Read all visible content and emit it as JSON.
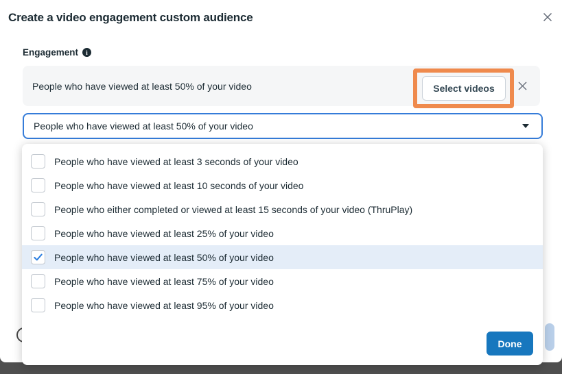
{
  "modal": {
    "title": "Create a video engagement custom audience"
  },
  "engagement": {
    "label": "Engagement",
    "info_icon_glyph": "i",
    "rule_row": {
      "text": "People who have viewed at least 50% of your video",
      "select_videos_label": "Select videos"
    },
    "select": {
      "value": "People who have viewed at least 50% of your video"
    }
  },
  "menu": {
    "options": [
      {
        "label": "People who have viewed at least 3 seconds of your video",
        "checked": false
      },
      {
        "label": "People who have viewed at least 10 seconds of your video",
        "checked": false
      },
      {
        "label": "People who either completed or viewed at least 15 seconds of your video (ThruPlay)",
        "checked": false
      },
      {
        "label": "People who have viewed at least 25% of your video",
        "checked": false
      },
      {
        "label": "People who have viewed at least 50% of your video",
        "checked": true
      },
      {
        "label": "People who have viewed at least 75% of your video",
        "checked": false
      },
      {
        "label": "People who have viewed at least 95% of your video",
        "checked": false
      }
    ],
    "done_label": "Done"
  },
  "colors": {
    "annotation_orange": "#EF8A4D",
    "primary_button_blue": "#1777BE",
    "focused_border_blue": "#357CD9",
    "checked_row_bg": "#E4EDF8",
    "check_blue": "#2D7FE0",
    "overlay_dark": "#4F4F4F"
  }
}
